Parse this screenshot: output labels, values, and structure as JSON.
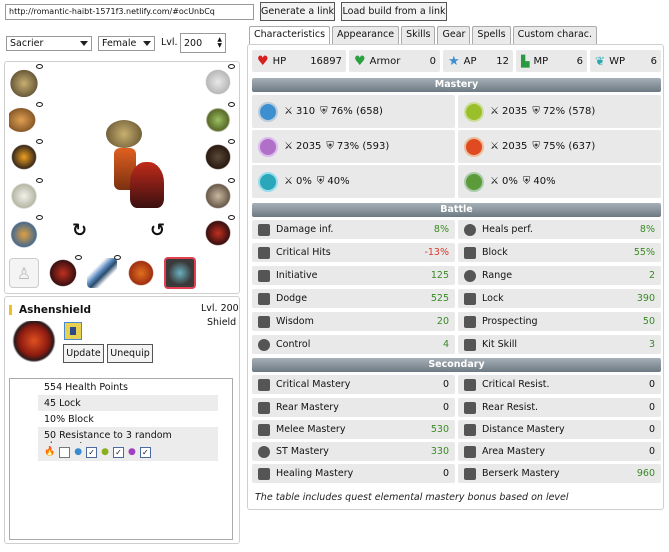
{
  "url": "http://romantic-haibt-1571f3.netlify.com/#ocUnbCq",
  "top_buttons": {
    "generate": "Generate a link",
    "load": "Load build from a link"
  },
  "character": {
    "class": "Sacrier",
    "gender": "Female",
    "level_label": "Lvl.",
    "level": "200"
  },
  "item": {
    "name": "Ashenshield",
    "level": "Lvl. 200",
    "type": "Shield",
    "update": "Update",
    "unequip": "Unequip",
    "effects": [
      "554 Health Points",
      "45 Lock",
      "10% Block",
      "50 Resistance to 3 random elements"
    ]
  },
  "tabs": [
    "Characteristics",
    "Appearance",
    "Skills",
    "Gear",
    "Spells",
    "Custom charac."
  ],
  "top_stats": [
    {
      "label": "HP",
      "value": "16897",
      "icon": "heart-icon"
    },
    {
      "label": "Armor",
      "value": "0",
      "icon": "heart-icon"
    },
    {
      "label": "AP",
      "value": "12",
      "icon": "star-icon"
    },
    {
      "label": "MP",
      "value": "6",
      "icon": "boot-icon"
    },
    {
      "label": "WP",
      "value": "6",
      "icon": "wing-icon"
    }
  ],
  "mastery_title": "Mastery",
  "mastery": [
    {
      "mast": "310",
      "res": "76% (658)",
      "color": "#3d8fcf"
    },
    {
      "mast": "2035",
      "res": "72% (578)",
      "color": "#9abf2a"
    },
    {
      "mast": "2035",
      "res": "73% (593)",
      "color": "#b070c8"
    },
    {
      "mast": "2035",
      "res": "75% (637)",
      "color": "#e04a20"
    },
    {
      "mast": "0%",
      "res": "40%",
      "color": "#2aa7b8"
    },
    {
      "mast": "0%",
      "res": "40%",
      "color": "#5c9a3a"
    }
  ],
  "battle_title": "Battle",
  "battle": [
    {
      "label": "Damage inf.",
      "value": "8%",
      "cls": "green"
    },
    {
      "label": "Heals perf.",
      "value": "8%",
      "cls": "green"
    },
    {
      "label": "Critical Hits",
      "value": "-13%",
      "cls": "red"
    },
    {
      "label": "Block",
      "value": "55%",
      "cls": "green"
    },
    {
      "label": "Initiative",
      "value": "125",
      "cls": "green"
    },
    {
      "label": "Range",
      "value": "2",
      "cls": "green"
    },
    {
      "label": "Dodge",
      "value": "525",
      "cls": "green"
    },
    {
      "label": "Lock",
      "value": "390",
      "cls": "green"
    },
    {
      "label": "Wisdom",
      "value": "20",
      "cls": "green"
    },
    {
      "label": "Prospecting",
      "value": "50",
      "cls": "green"
    },
    {
      "label": "Control",
      "value": "4",
      "cls": "green"
    },
    {
      "label": "Kit Skill",
      "value": "3",
      "cls": "green"
    }
  ],
  "secondary_title": "Secondary",
  "secondary": [
    {
      "label": "Critical Mastery",
      "value": "0",
      "cls": ""
    },
    {
      "label": "Critical Resist.",
      "value": "0",
      "cls": ""
    },
    {
      "label": "Rear Mastery",
      "value": "0",
      "cls": ""
    },
    {
      "label": "Rear Resist.",
      "value": "0",
      "cls": ""
    },
    {
      "label": "Melee Mastery",
      "value": "530",
      "cls": "green"
    },
    {
      "label": "Distance Mastery",
      "value": "0",
      "cls": ""
    },
    {
      "label": "ST Mastery",
      "value": "330",
      "cls": "green"
    },
    {
      "label": "Area Mastery",
      "value": "0",
      "cls": ""
    },
    {
      "label": "Healing Mastery",
      "value": "0",
      "cls": ""
    },
    {
      "label": "Berserk Mastery",
      "value": "960",
      "cls": "green"
    }
  ],
  "note": "The table includes quest elemental mastery bonus based on level"
}
